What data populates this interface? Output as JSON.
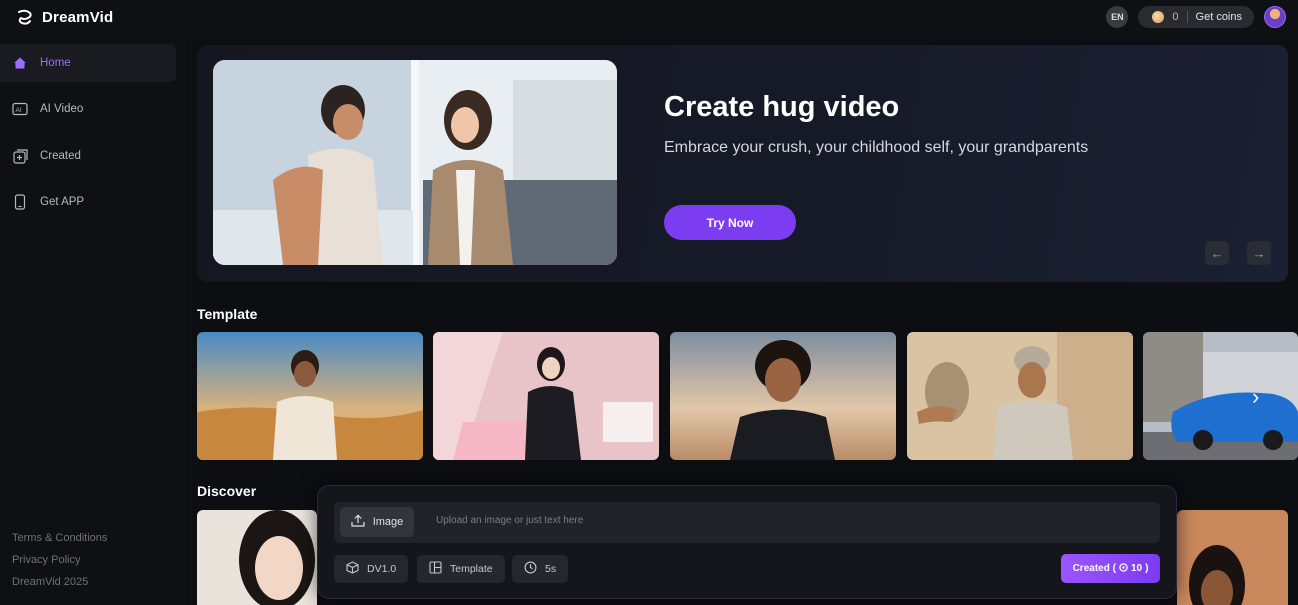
{
  "app": {
    "name": "DreamVid"
  },
  "header": {
    "lang_label": "EN",
    "coins_count": "0",
    "get_coins_label": "Get coins"
  },
  "sidebar": {
    "items": [
      {
        "label": "Home",
        "icon": "home-icon"
      },
      {
        "label": "AI Video",
        "icon": "ai-video-icon"
      },
      {
        "label": "Created",
        "icon": "created-icon"
      },
      {
        "label": "Get APP",
        "icon": "phone-icon"
      }
    ],
    "footer": {
      "terms": "Terms & Conditions",
      "privacy": "Privacy Policy",
      "copyright": "DreamVid 2025"
    }
  },
  "hero": {
    "title": "Create hug video",
    "subtitle": "Embrace your crush, your childhood self, your grandparents",
    "cta": "Try Now",
    "prev_glyph": "←",
    "next_glyph": "→"
  },
  "sections": {
    "template": "Template",
    "discover": "Discover"
  },
  "templates_next_glyph": "›",
  "composer": {
    "image_button": "Image",
    "placeholder": "Upload an image or just text here",
    "model_chip": "DV1.0",
    "template_chip": "Template",
    "duration_chip": "5s",
    "create_prefix": "Created (",
    "create_cost": "10",
    "create_suffix": ")"
  },
  "colors": {
    "accent": "#7c3cf0",
    "active_nav": "#9d6cff",
    "background": "#0d0e12"
  }
}
